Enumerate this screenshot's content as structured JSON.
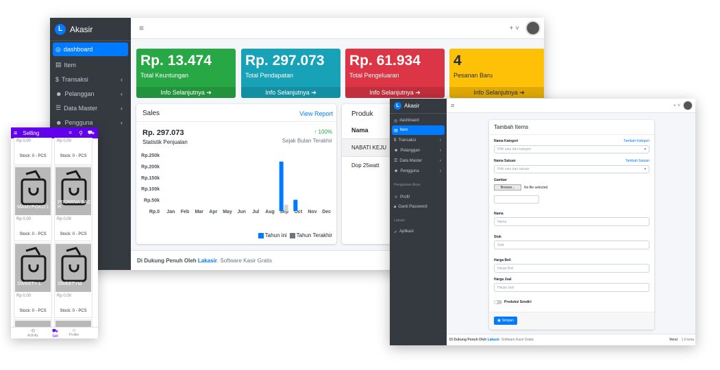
{
  "win1": {
    "brand": "Akasir",
    "brand_logo": "L",
    "menu_icon": "hamburger-icon",
    "topbar_plus": "+ ˅",
    "nav": [
      {
        "icon": "dashboard-icon",
        "label": "dashboard",
        "active": true
      },
      {
        "icon": "file-icon",
        "label": "Item",
        "chevron": ""
      },
      {
        "icon": "dollar-icon",
        "label": "Transaksi",
        "chevron": "‹"
      },
      {
        "icon": "users-icon",
        "label": "Pelanggan",
        "chevron": "‹"
      },
      {
        "icon": "database-icon",
        "label": "Data Master",
        "chevron": "‹"
      },
      {
        "icon": "users-icon",
        "label": "Pengguna",
        "chevron": "‹"
      }
    ],
    "boxes": [
      {
        "value": "Rp. 13.474",
        "label": "Total Keuntungan",
        "footer": "Info Selanjutnya ➔",
        "color": "#28a745"
      },
      {
        "value": "Rp. 297.073",
        "label": "Total Pendapatan",
        "footer": "Info Selanjutnya ➔",
        "color": "#17a2b8"
      },
      {
        "value": "Rp. 61.934",
        "label": "Total Pengeluaran",
        "footer": "Info Selanjutnya ➔",
        "color": "#dc3545"
      },
      {
        "value": "4",
        "label": "Pesanan Baru",
        "footer": "Info Selanjutnya ➔",
        "color": "#ffc107"
      }
    ],
    "sales": {
      "title": "Sales",
      "view_report": "View Report",
      "amount": "Rp. 297.073",
      "subtitle": "Statistik Penjualan",
      "growth": "↑ 100%",
      "growth_label": "Sejak Bulan Terakhir",
      "legend_this": "Tahun ini",
      "legend_last": "Tahun Terakhir"
    },
    "produk": {
      "title": "Produk",
      "col": "Nama",
      "rows": [
        "NABATI KEJU",
        "Dop 25watt"
      ]
    },
    "footer_prefix": "Di Dukung Penuh Oleh ",
    "footer_brand": "Lakasir",
    "footer_suffix": ". Software Kasir Gratis"
  },
  "chart_data": {
    "type": "bar",
    "categories": [
      "Jan",
      "Feb",
      "Mar",
      "Apr",
      "May",
      "Jun",
      "Jul",
      "Aug",
      "Sep",
      "Oct",
      "Nov",
      "Dec"
    ],
    "series": [
      {
        "name": "Tahun ini",
        "values": [
          0,
          0,
          0,
          0,
          0,
          0,
          0,
          0,
          220000,
          50000,
          0,
          0
        ],
        "color": "#007bff"
      },
      {
        "name": "Tahun Terakhir",
        "values": [
          0,
          0,
          0,
          0,
          0,
          0,
          0,
          0,
          28000,
          0,
          0,
          0
        ],
        "color": "#ced4da"
      }
    ],
    "yticks": [
      "Rp.250k",
      "Rp.200k",
      "Rp.150k",
      "Rp.100k",
      "Rp.50k",
      "Rp.0"
    ],
    "ylim": [
      0,
      250000
    ],
    "legend": "bottom-right"
  },
  "win2": {
    "brand": "Akasir",
    "brand_logo": "L",
    "topbar_plus": "+ ˅",
    "nav": [
      {
        "icon": "dashboard-icon",
        "label": "dashboard"
      },
      {
        "icon": "file-icon",
        "label": "Item",
        "active": true
      },
      {
        "icon": "dollar-icon",
        "label": "Transaksi",
        "chevron": "‹"
      },
      {
        "icon": "users-icon",
        "label": "Pelanggan",
        "chevron": "‹"
      },
      {
        "icon": "database-icon",
        "label": "Data Master",
        "chevron": "‹"
      },
      {
        "icon": "users-icon",
        "label": "Pengguna",
        "chevron": "‹"
      }
    ],
    "section_akun": "Pengaturan Akun",
    "nav2": [
      {
        "icon": "user-icon",
        "label": "Profil"
      },
      {
        "icon": "lock-icon",
        "label": "Ganti Password"
      }
    ],
    "section_lakasir": "Lakasir",
    "nav3": [
      {
        "icon": "rocket-icon",
        "label": "Aplikasi"
      }
    ],
    "form": {
      "title": "Tambah Items",
      "kategori_label": "Nama Kategori",
      "kategori_link": "Tambah Kategori",
      "kategori_placeholder": "Pilih satu dari kategori",
      "satuan_label": "Nama Satuan",
      "satuan_link": "Tambah Satuan",
      "satuan_placeholder": "Pilih satu dari satuan",
      "gambar_label": "Gambar",
      "browse": "Browse...",
      "no_file": "No file selected.",
      "nama_label": "Nama",
      "nama_placeholder": "Nama",
      "stok_label": "Stok",
      "stok_placeholder": "Stok",
      "beli_label": "Harga Beli",
      "beli_placeholder": "Harga Beli",
      "jual_label": "Harga Jual",
      "jual_placeholder": "Harga Jual",
      "toggle_label": "Produksi Sendiri",
      "save": "Simpan"
    },
    "footer_prefix": "Di Dukung Penuh Oleh ",
    "footer_brand": "Lakasir",
    "footer_suffix": ". Software Kasir Gratis",
    "version_label": "Versi",
    "version": "1.0-beta"
  },
  "phone": {
    "title": "Selling",
    "top_price": [
      "Rp 0,00",
      "Rp 0,00"
    ],
    "top_stock": [
      "Stock: 0 - PCS",
      "Stock: 0 - PCS"
    ],
    "products": [
      {
        "name": "MAMYPOKO L",
        "price": "Rp 0,00",
        "stock": "Stock: 0 - PCS"
      },
      {
        "name": "PROMINA SAC H",
        "price": "Rp 0,00",
        "stock": "Stock: 0 - PCS"
      },
      {
        "name": "SWEETY L",
        "price": "Rp 0,00",
        "stock": "Stock: 0 - PCS"
      },
      {
        "name": "SWEETYM",
        "price": "Rp 0,00",
        "stock": "Stock: 0 - PCS"
      }
    ],
    "bottom_nav": [
      {
        "icon": "history-icon",
        "label": "Activity"
      },
      {
        "icon": "cart-icon",
        "label": "Sell",
        "active": true
      },
      {
        "icon": "profile-icon",
        "label": "Profile"
      }
    ],
    "accent": "#6200ee"
  }
}
